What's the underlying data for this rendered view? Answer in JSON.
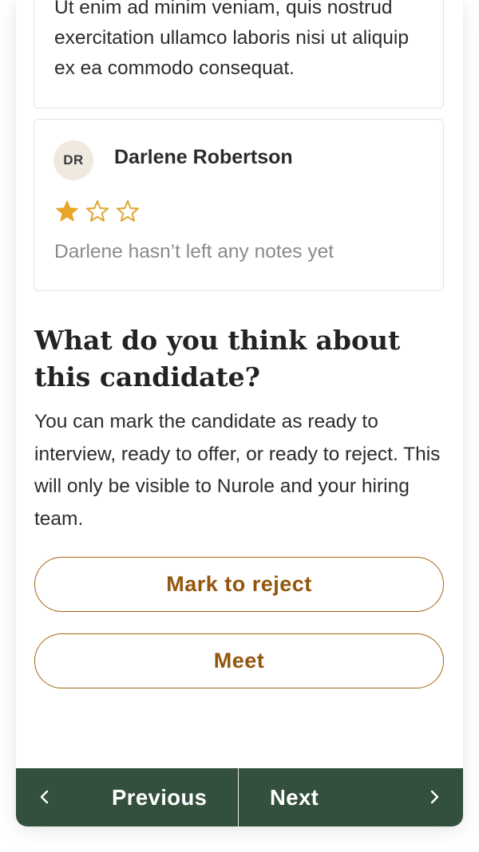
{
  "notes": [
    {
      "text": "Ut enim ad minim veniam, quis nostrud exercitation ullamco laboris nisi ut aliquip ex ea commodo consequat."
    },
    {
      "initials": "DR",
      "name": "Darlene Robertson",
      "rating": 1,
      "rating_max": 3,
      "note": "Darlene hasn’t left any notes yet"
    }
  ],
  "feedback": {
    "question": "What do you think about this candidate?",
    "description": "You can mark the candidate as ready to interview, ready to offer, or ready to reject. This will only be visible to Nurole and your hiring team.",
    "reject_label": "Mark to reject",
    "meet_label": "Meet"
  },
  "navigation": {
    "previous_label": "Previous",
    "next_label": "Next"
  },
  "colors": {
    "accent": "#93560c",
    "button_border": "#a76412",
    "nav_bar": "#33503c",
    "star_filled": "#e8a526",
    "star_outline": "#e0a630",
    "avatar_bg": "#efe9df"
  },
  "icons": {
    "star": "star-icon",
    "previous": "chevron-left-icon",
    "next": "chevron-right-icon"
  }
}
